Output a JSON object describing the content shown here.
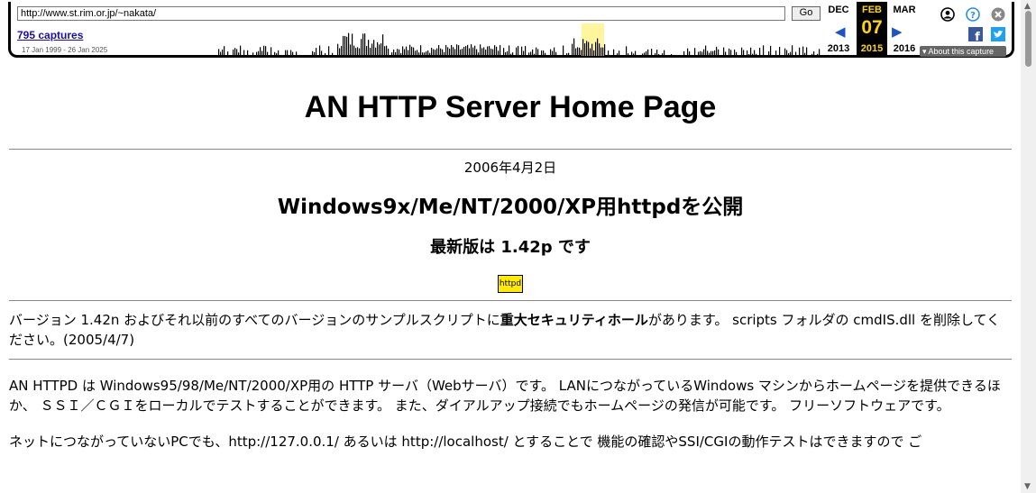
{
  "toolbar": {
    "url": "http://www.st.rim.or.jp/~nakata/",
    "go_label": "Go",
    "captures_label": "795 captures",
    "date_range": "17 Jan 1999 - 26 Jan 2025",
    "prev_month": "DEC",
    "prev_year": "2013",
    "cur_month": "FEB",
    "cur_day": "07",
    "cur_year": "2015",
    "next_month": "MAR",
    "next_year": "2016",
    "about_label": "▾ About this capture",
    "icons": [
      "user-icon",
      "help-icon",
      "close-icon",
      "facebook-icon",
      "twitter-icon"
    ],
    "colors": {
      "accent": "#1e53c8",
      "current": "#ffd700",
      "highlight": "#fff59d"
    }
  },
  "page": {
    "title": "AN HTTP Server Home Page",
    "date": "2006年4月2日",
    "headline": "Windows9x/Me/NT/2000/XP用httpdを公開",
    "latest": "最新版は 1.42p です",
    "badge": "httpd",
    "security_pre": "バージョン 1.42n およびそれ以前のすべてのバージョンのサンプルスクリプトに",
    "security_bold": "重大セキュリティホール",
    "security_post": "があります。 scripts フォルダの cmdIS.dll を削除してください。(2005/4/7)",
    "about": "AN HTTPD は Windows95/98/Me/NT/2000/XP用の HTTP サーバ（Webサーバ）です。 LANにつながっているWindows マシンからホームページを提供できるほか、 ＳＳＩ／ＣＧＩをローカルでテストすることができます。 また、ダイアルアップ接続でもホームページの発信が可能です。 フリーソフトウェアです。",
    "network": "ネットにつながっていないPCでも、http://127.0.0.1/ あるいは http://localhost/ とすることで 機能の確認やSSI/CGIの動作テストはできますので ご"
  }
}
